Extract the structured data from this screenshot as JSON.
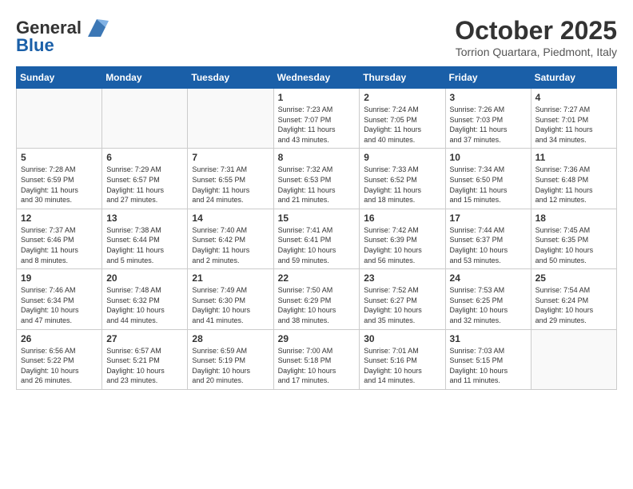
{
  "header": {
    "logo_line1": "General",
    "logo_line2": "Blue",
    "month_title": "October 2025",
    "location": "Torrion Quartara, Piedmont, Italy"
  },
  "weekdays": [
    "Sunday",
    "Monday",
    "Tuesday",
    "Wednesday",
    "Thursday",
    "Friday",
    "Saturday"
  ],
  "weeks": [
    [
      {
        "day": "",
        "info": ""
      },
      {
        "day": "",
        "info": ""
      },
      {
        "day": "",
        "info": ""
      },
      {
        "day": "1",
        "info": "Sunrise: 7:23 AM\nSunset: 7:07 PM\nDaylight: 11 hours\nand 43 minutes."
      },
      {
        "day": "2",
        "info": "Sunrise: 7:24 AM\nSunset: 7:05 PM\nDaylight: 11 hours\nand 40 minutes."
      },
      {
        "day": "3",
        "info": "Sunrise: 7:26 AM\nSunset: 7:03 PM\nDaylight: 11 hours\nand 37 minutes."
      },
      {
        "day": "4",
        "info": "Sunrise: 7:27 AM\nSunset: 7:01 PM\nDaylight: 11 hours\nand 34 minutes."
      }
    ],
    [
      {
        "day": "5",
        "info": "Sunrise: 7:28 AM\nSunset: 6:59 PM\nDaylight: 11 hours\nand 30 minutes."
      },
      {
        "day": "6",
        "info": "Sunrise: 7:29 AM\nSunset: 6:57 PM\nDaylight: 11 hours\nand 27 minutes."
      },
      {
        "day": "7",
        "info": "Sunrise: 7:31 AM\nSunset: 6:55 PM\nDaylight: 11 hours\nand 24 minutes."
      },
      {
        "day": "8",
        "info": "Sunrise: 7:32 AM\nSunset: 6:53 PM\nDaylight: 11 hours\nand 21 minutes."
      },
      {
        "day": "9",
        "info": "Sunrise: 7:33 AM\nSunset: 6:52 PM\nDaylight: 11 hours\nand 18 minutes."
      },
      {
        "day": "10",
        "info": "Sunrise: 7:34 AM\nSunset: 6:50 PM\nDaylight: 11 hours\nand 15 minutes."
      },
      {
        "day": "11",
        "info": "Sunrise: 7:36 AM\nSunset: 6:48 PM\nDaylight: 11 hours\nand 12 minutes."
      }
    ],
    [
      {
        "day": "12",
        "info": "Sunrise: 7:37 AM\nSunset: 6:46 PM\nDaylight: 11 hours\nand 8 minutes."
      },
      {
        "day": "13",
        "info": "Sunrise: 7:38 AM\nSunset: 6:44 PM\nDaylight: 11 hours\nand 5 minutes."
      },
      {
        "day": "14",
        "info": "Sunrise: 7:40 AM\nSunset: 6:42 PM\nDaylight: 11 hours\nand 2 minutes."
      },
      {
        "day": "15",
        "info": "Sunrise: 7:41 AM\nSunset: 6:41 PM\nDaylight: 10 hours\nand 59 minutes."
      },
      {
        "day": "16",
        "info": "Sunrise: 7:42 AM\nSunset: 6:39 PM\nDaylight: 10 hours\nand 56 minutes."
      },
      {
        "day": "17",
        "info": "Sunrise: 7:44 AM\nSunset: 6:37 PM\nDaylight: 10 hours\nand 53 minutes."
      },
      {
        "day": "18",
        "info": "Sunrise: 7:45 AM\nSunset: 6:35 PM\nDaylight: 10 hours\nand 50 minutes."
      }
    ],
    [
      {
        "day": "19",
        "info": "Sunrise: 7:46 AM\nSunset: 6:34 PM\nDaylight: 10 hours\nand 47 minutes."
      },
      {
        "day": "20",
        "info": "Sunrise: 7:48 AM\nSunset: 6:32 PM\nDaylight: 10 hours\nand 44 minutes."
      },
      {
        "day": "21",
        "info": "Sunrise: 7:49 AM\nSunset: 6:30 PM\nDaylight: 10 hours\nand 41 minutes."
      },
      {
        "day": "22",
        "info": "Sunrise: 7:50 AM\nSunset: 6:29 PM\nDaylight: 10 hours\nand 38 minutes."
      },
      {
        "day": "23",
        "info": "Sunrise: 7:52 AM\nSunset: 6:27 PM\nDaylight: 10 hours\nand 35 minutes."
      },
      {
        "day": "24",
        "info": "Sunrise: 7:53 AM\nSunset: 6:25 PM\nDaylight: 10 hours\nand 32 minutes."
      },
      {
        "day": "25",
        "info": "Sunrise: 7:54 AM\nSunset: 6:24 PM\nDaylight: 10 hours\nand 29 minutes."
      }
    ],
    [
      {
        "day": "26",
        "info": "Sunrise: 6:56 AM\nSunset: 5:22 PM\nDaylight: 10 hours\nand 26 minutes."
      },
      {
        "day": "27",
        "info": "Sunrise: 6:57 AM\nSunset: 5:21 PM\nDaylight: 10 hours\nand 23 minutes."
      },
      {
        "day": "28",
        "info": "Sunrise: 6:59 AM\nSunset: 5:19 PM\nDaylight: 10 hours\nand 20 minutes."
      },
      {
        "day": "29",
        "info": "Sunrise: 7:00 AM\nSunset: 5:18 PM\nDaylight: 10 hours\nand 17 minutes."
      },
      {
        "day": "30",
        "info": "Sunrise: 7:01 AM\nSunset: 5:16 PM\nDaylight: 10 hours\nand 14 minutes."
      },
      {
        "day": "31",
        "info": "Sunrise: 7:03 AM\nSunset: 5:15 PM\nDaylight: 10 hours\nand 11 minutes."
      },
      {
        "day": "",
        "info": ""
      }
    ]
  ]
}
